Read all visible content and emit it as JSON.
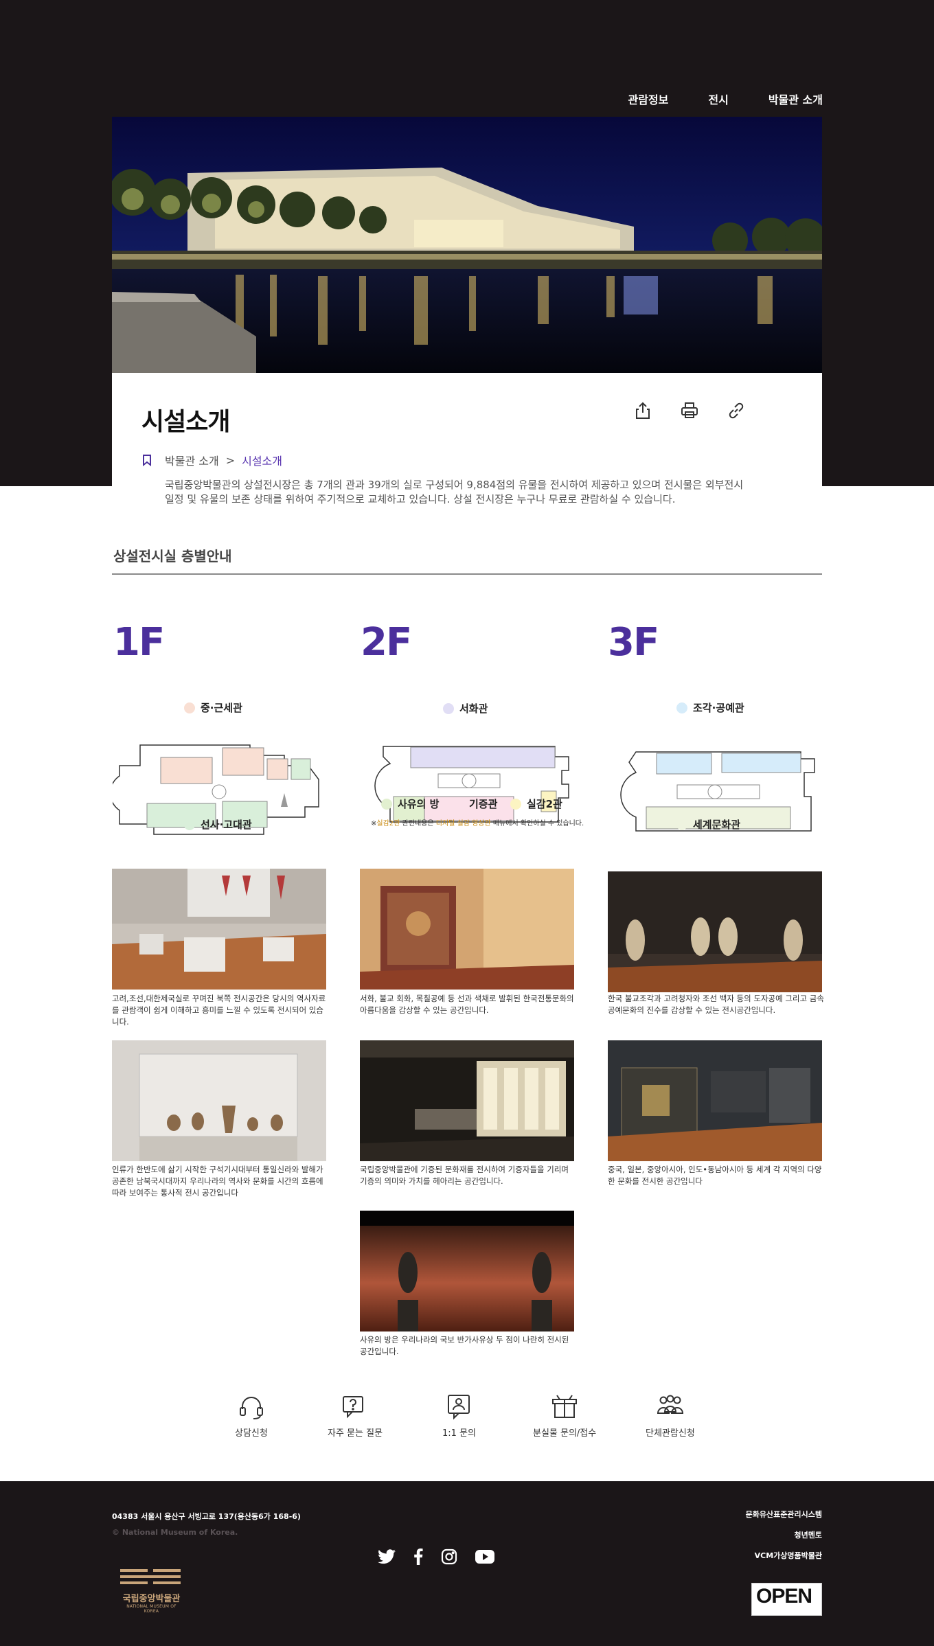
{
  "nav": {
    "items": [
      "관람정보",
      "전시",
      "박물관 소개"
    ]
  },
  "page": {
    "title": "시설소개",
    "breadcrumb": {
      "parent": "박물관 소개",
      "separator": ">",
      "current": "시설소개"
    },
    "intro": "국립중앙박물관의 상설전시장은 총 7개의 관과 39개의 실로 구성되어 9,884점의 유물을 전시하여 제공하고 있으며 전시물은 외부전시 일정 및 유물의 보존 상태를 위하여 주기적으로 교체하고 있습니다. 상설 전시장은 누구나 무료로 관람하실 수 있습니다."
  },
  "section": {
    "title": "상설전시실 층별안내"
  },
  "floors": [
    {
      "label": "1F",
      "halls": [
        {
          "name": "중·근세관",
          "color": "#f9dfd3"
        },
        {
          "name": "선사·고대관",
          "color": "#d9efda"
        }
      ]
    },
    {
      "label": "2F",
      "halls": [
        {
          "name": "서화관",
          "color": "#e1def5"
        },
        {
          "name": "사유의 방",
          "color": "#e2f0d0"
        },
        {
          "name": "기증관",
          "color": "#fbe1ea"
        },
        {
          "name": "실감2관",
          "color": "#fcf4c2"
        }
      ],
      "note_prefix": "※",
      "note_hl1": "실감2관",
      "note_mid": " 관련내용은 ",
      "note_hl2": "디지털 실감 영상관",
      "note_suffix": " 메뉴에서 확인하실 수 있습니다."
    },
    {
      "label": "3F",
      "halls": [
        {
          "name": "조각·공예관",
          "color": "#d6ecfa"
        },
        {
          "name": "세계문화관",
          "color": "#eef3df"
        }
      ]
    }
  ],
  "galleries": [
    {
      "caption": "고려,조선,대한제국실로 꾸며진 북쪽 전시공간은 당시의 역사자료를 관람객이 쉽게 이해하고 흥미를 느낄 수 있도록 전시되어 있습니다."
    },
    {
      "caption": "서화, 불교 회화, 목칠공예 등 선과 색채로 발휘된 한국전통문화의 아름다움을 감상할 수 있는 공간입니다."
    },
    {
      "caption": "한국 불교조각과 고려청자와 조선 백자 등의 도자공예 그리고 금속공예문화의 진수를 감상할 수 있는 전시공간입니다."
    },
    {
      "caption": "인류가 한반도에 삶기 시작한 구석기시대부터 통일신라와 발해가 공존한 남북국시대까지 우리나라의 역사와 문화를 시간의 흐름에 따라 보여주는 통사적 전시 공간입니다"
    },
    {
      "caption": "국립중앙박물관에 기증된 문화재를 전시하여 기증자들을 기리며 기증의 의미와 가치를 헤아리는 공간입니다."
    },
    {
      "caption": "중국, 일본, 중앙아시아, 인도•동남아시아 등 세계 각 지역의 다양한 문화를 전시한 공간입니다"
    },
    {
      "caption": "사유의 방은 우리나라의 국보 반가사유상 두 점이 나란히 전시된 공간입니다."
    }
  ],
  "quick_links": [
    {
      "label": "상담신청",
      "icon": "headset-icon"
    },
    {
      "label": "자주 묻는 질문",
      "icon": "faq-chat-icon"
    },
    {
      "label": "1:1 문의",
      "icon": "person-chat-icon"
    },
    {
      "label": "분실물 문의/접수",
      "icon": "box-icon"
    },
    {
      "label": "단체관람신청",
      "icon": "group-icon"
    }
  ],
  "footer": {
    "address": "04383 서울시 용산구 서빙고로 137(용산동6가 168-6)",
    "copyright": "© National Museum of Korea.",
    "links": [
      "문화유산표준관리시스템",
      "청년멘토",
      "VCM가상명품박물관"
    ],
    "logo_ko": "국립중앙박물관",
    "logo_en": "NATIONAL MUSEUM OF KOREA",
    "badge": "OPEN",
    "social": [
      "twitter-icon",
      "facebook-icon",
      "instagram-icon",
      "youtube-icon"
    ]
  },
  "colors": {
    "accent": "#4b2f9c",
    "dark": "#1b1618",
    "breadcrumb_current": "#5a36b0"
  }
}
